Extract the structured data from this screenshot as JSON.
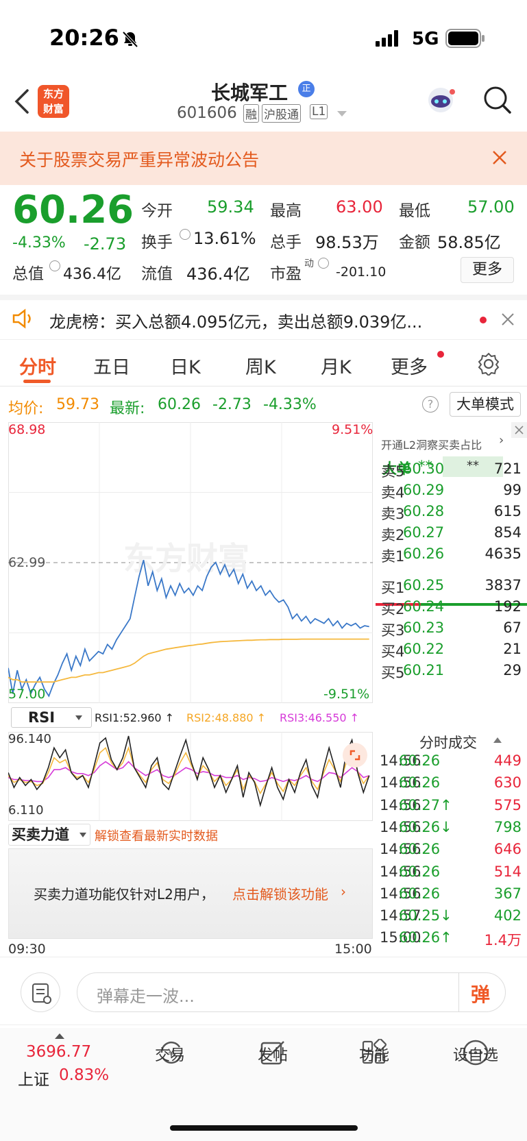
{
  "status": {
    "time": "20:26",
    "network": "5G"
  },
  "header": {
    "logo_line1": "东方",
    "logo_line2": "财富",
    "stock_name": "长城军工",
    "name_badge": "正",
    "stock_code": "601606",
    "tags": [
      "融",
      "沪股通",
      "L1"
    ]
  },
  "notice": {
    "text": "关于股票交易严重异常波动公告"
  },
  "quote": {
    "price": "60.26",
    "change_pct": "-4.33%",
    "change": "-2.73",
    "open_label": "今开",
    "open": "59.34",
    "high_label": "最高",
    "high": "63.00",
    "low_label": "最低",
    "low": "57.00",
    "turnover_label": "换手",
    "turnover": "13.61%",
    "volume_label": "总手",
    "volume": "98.53万",
    "amount_label": "金额",
    "amount": "58.85亿",
    "mktcap_label": "总值",
    "mktcap": "436.4亿",
    "float_label": "流值",
    "float": "436.4亿",
    "pe_label": "市盈",
    "pe_sup": "动",
    "pe": "-201.10",
    "more_button": "更多"
  },
  "dragon": {
    "text": "龙虎榜：买入总额4.095亿元，卖出总额9.039亿..."
  },
  "tabs": [
    "分时",
    "五日",
    "日K",
    "周K",
    "月K",
    "更多"
  ],
  "chart_header": {
    "avg_label": "均价:",
    "avg": "59.73",
    "last_label": "最新:",
    "last": "60.26",
    "chg": "-2.73",
    "chg_pct": "-4.33%",
    "mode_button": "大单模式"
  },
  "chart_labels": {
    "y_top": "68.98",
    "y_mid": "62.99",
    "y_bottom": "57.00",
    "pct_top": "9.51%",
    "pct_bottom": "-9.51%",
    "watermark": "东方财富",
    "time_start": "09:30",
    "time_end": "15:00"
  },
  "chart_data": {
    "type": "line",
    "title": "",
    "ylim": [
      57.0,
      68.98
    ],
    "series": [
      {
        "name": "最新",
        "color": "#3a78c8",
        "values": [
          58.5,
          57.4,
          58.4,
          57.6,
          58.0,
          57.4,
          57.8,
          58.1,
          57.6,
          57.3,
          57.8,
          58.2,
          58.7,
          59.1,
          58.4,
          59.0,
          58.6,
          59.3,
          58.8,
          59.0,
          59.2,
          59.1,
          59.5,
          59.3,
          59.7,
          60.0,
          60.3,
          60.6,
          61.5,
          62.4,
          63.1,
          62.0,
          62.6,
          61.8,
          62.3,
          61.5,
          62.0,
          61.6,
          62.1,
          61.7,
          61.9,
          61.6,
          62.0,
          61.8,
          62.4,
          62.8,
          63.0,
          62.5,
          62.9,
          62.4,
          62.7,
          62.1,
          62.5,
          61.9,
          62.2,
          61.8,
          62.0,
          61.6,
          61.8,
          61.5,
          61.3,
          61.4,
          61.1,
          60.6,
          60.8,
          60.5,
          60.7,
          60.4,
          60.6,
          60.5,
          60.4,
          60.6,
          60.3,
          60.5,
          60.2,
          60.4,
          60.3,
          60.4,
          60.2,
          60.3,
          60.26
        ]
      },
      {
        "name": "均价",
        "color": "#f5b83d",
        "values": [
          58.1,
          58.0,
          58.0,
          57.9,
          57.9,
          57.9,
          57.9,
          57.9,
          57.9,
          57.9,
          57.9,
          57.95,
          58.0,
          58.05,
          58.1,
          58.1,
          58.15,
          58.2,
          58.2,
          58.25,
          58.3,
          58.3,
          58.35,
          58.4,
          58.45,
          58.5,
          58.55,
          58.6,
          58.7,
          58.85,
          59.0,
          59.1,
          59.15,
          59.2,
          59.25,
          59.3,
          59.33,
          59.36,
          59.39,
          59.42,
          59.45,
          59.47,
          59.5,
          59.52,
          59.55,
          59.58,
          59.6,
          59.62,
          59.63,
          59.64,
          59.65,
          59.66,
          59.67,
          59.68,
          59.68,
          59.69,
          59.7,
          59.7,
          59.71,
          59.71,
          59.71,
          59.72,
          59.72,
          59.72,
          59.72,
          59.73,
          59.73,
          59.73,
          59.73,
          59.73,
          59.73,
          59.73,
          59.73,
          59.73,
          59.73,
          59.73,
          59.73,
          59.73,
          59.73,
          59.73,
          59.73
        ]
      }
    ]
  },
  "rsi": {
    "selector": "RSI",
    "rsi1_label": "RSI1:52.960 ↑",
    "rsi2_label": "RSI2:48.880 ↑",
    "rsi3_label": "RSI3:46.550 ↑",
    "y_top": "96.140",
    "y_bottom": "6.110"
  },
  "rsi_data": {
    "ylim": [
      6.11,
      96.14
    ],
    "rsi1": [
      55,
      40,
      50,
      42,
      48,
      38,
      45,
      60,
      80,
      70,
      78,
      55,
      48,
      52,
      40,
      62,
      85,
      90,
      68,
      58,
      70,
      92,
      60,
      50,
      40,
      62,
      70,
      44,
      38,
      55,
      72,
      88,
      65,
      48,
      70,
      58,
      40,
      52,
      35,
      48,
      62,
      30,
      55,
      45,
      22,
      42,
      60,
      40,
      28,
      48,
      35,
      55,
      68,
      42,
      30,
      58,
      80,
      60,
      40,
      75,
      88,
      55,
      35,
      52
    ],
    "rsi2": [
      52,
      45,
      48,
      45,
      46,
      42,
      44,
      55,
      70,
      65,
      68,
      55,
      50,
      52,
      45,
      58,
      75,
      80,
      65,
      58,
      65,
      80,
      60,
      52,
      45,
      58,
      65,
      48,
      44,
      52,
      65,
      75,
      62,
      50,
      62,
      56,
      46,
      52,
      42,
      48,
      58,
      38,
      52,
      46,
      34,
      44,
      55,
      44,
      36,
      48,
      42,
      52,
      60,
      46,
      38,
      54,
      68,
      58,
      46,
      65,
      75,
      56,
      44,
      52
    ],
    "rsi3": [
      50,
      48,
      48,
      47,
      47,
      46,
      46,
      50,
      58,
      58,
      60,
      56,
      54,
      54,
      52,
      55,
      62,
      66,
      62,
      58,
      60,
      66,
      60,
      56,
      52,
      55,
      58,
      52,
      50,
      52,
      56,
      60,
      58,
      54,
      56,
      55,
      52,
      52,
      50,
      50,
      52,
      48,
      50,
      49,
      46,
      47,
      50,
      48,
      46,
      48,
      47,
      49,
      52,
      48,
      46,
      50,
      55,
      54,
      50,
      55,
      60,
      56,
      50,
      52
    ]
  },
  "buysell": {
    "selector": "买卖力道",
    "unlock_hint": "解锁查看最新实时数据",
    "panel_text": "买卖力道功能仅针对L2用户，",
    "panel_link": "点击解锁该功能"
  },
  "orderbook": {
    "promo": "开通L2洞察买卖占比",
    "big_label": "大单",
    "big_v1": "**",
    "big_v2": "**",
    "asks": [
      {
        "label": "卖5",
        "price": "60.30",
        "vol": "721"
      },
      {
        "label": "卖4",
        "price": "60.29",
        "vol": "99"
      },
      {
        "label": "卖3",
        "price": "60.28",
        "vol": "615"
      },
      {
        "label": "卖2",
        "price": "60.27",
        "vol": "854"
      },
      {
        "label": "卖1",
        "price": "60.26",
        "vol": "4635"
      }
    ],
    "bids": [
      {
        "label": "买1",
        "price": "60.25",
        "vol": "3837"
      },
      {
        "label": "买2",
        "price": "60.24",
        "vol": "192"
      },
      {
        "label": "买3",
        "price": "60.23",
        "vol": "67"
      },
      {
        "label": "买4",
        "price": "60.22",
        "vol": "21"
      },
      {
        "label": "买5",
        "price": "60.21",
        "vol": "29"
      }
    ],
    "bid_ratio": 0.3
  },
  "trades": {
    "title": "分时成交",
    "rows": [
      {
        "time": "14:56",
        "price": "60.26",
        "vol": "449",
        "pc": "green",
        "vc": "red"
      },
      {
        "time": "14:56",
        "price": "60.26",
        "vol": "630",
        "pc": "green",
        "vc": "red"
      },
      {
        "time": "14:56",
        "price": "60.27↑",
        "vol": "575",
        "pc": "green",
        "vc": "red"
      },
      {
        "time": "14:56",
        "price": "60.26↓",
        "vol": "798",
        "pc": "green",
        "vc": "green"
      },
      {
        "time": "14:56",
        "price": "60.26",
        "vol": "646",
        "pc": "green",
        "vc": "red"
      },
      {
        "time": "14:56",
        "price": "60.26",
        "vol": "514",
        "pc": "green",
        "vc": "red"
      },
      {
        "time": "14:56",
        "price": "60.26",
        "vol": "367",
        "pc": "green",
        "vc": "green"
      },
      {
        "time": "14:57",
        "price": "60.25↓",
        "vol": "402",
        "pc": "green",
        "vc": "green"
      },
      {
        "time": "15:00",
        "price": "60.26↑",
        "vol": "1.4万",
        "pc": "green",
        "vc": "red"
      }
    ]
  },
  "comment": {
    "placeholder": "弹幕走一波...",
    "danmu_button": "弹"
  },
  "bottom": {
    "index_value": "3696.77",
    "index_name": "上证",
    "index_pct": "0.83%",
    "tabs": [
      "交易",
      "发帖",
      "功能",
      "设自选"
    ]
  }
}
